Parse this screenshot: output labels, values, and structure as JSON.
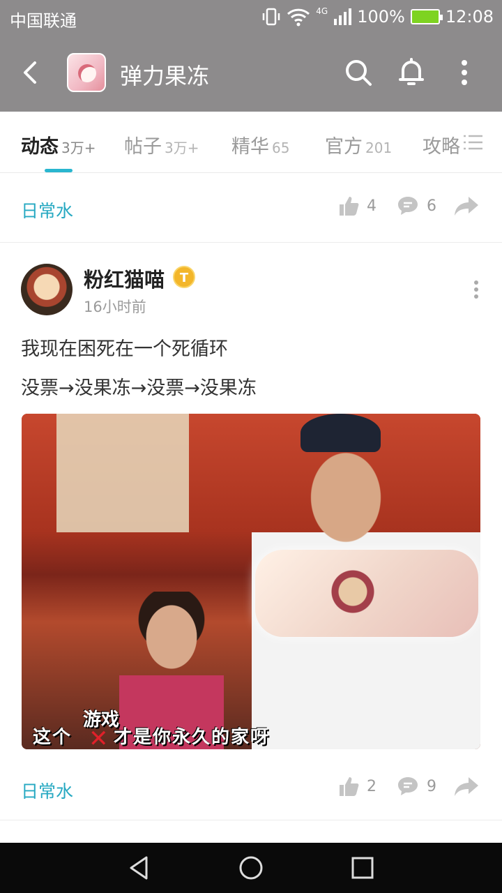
{
  "status_bar": {
    "carrier": "中国联通",
    "network": "4G",
    "battery": "100%",
    "time": "12:08"
  },
  "header": {
    "title": "弹力果冻"
  },
  "tabs": [
    {
      "label": "动态",
      "count": "3万+",
      "active": true
    },
    {
      "label": "帖子",
      "count": "3万+"
    },
    {
      "label": "精华",
      "count": "65"
    },
    {
      "label": "官方",
      "count": "201"
    },
    {
      "label": "攻略"
    }
  ],
  "prev_post_footer": {
    "tag": "日常水",
    "likes": "4",
    "comments": "6"
  },
  "post": {
    "author": "粉红猫喵",
    "badge": "T",
    "time": "16小时前",
    "line1": "我现在困死在一个死循环",
    "line2": "没票→没果冻→没票→没果冻",
    "image_caption": "这个",
    "image_caption_rest": "才是你永久的家呀",
    "image_overlay": "游戏",
    "image_strike": "✕",
    "footer": {
      "tag": "日常水",
      "likes": "2",
      "comments": "9"
    }
  },
  "accent_color": "#29b6cf"
}
